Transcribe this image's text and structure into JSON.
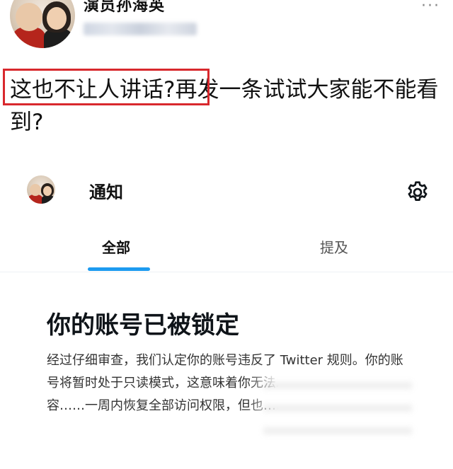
{
  "tweet": {
    "author_name": "演员孙海英",
    "more_label": "···",
    "highlighted_text": "这也不让人讲话?",
    "rest_text": "再发一条试试大家能不能看到?"
  },
  "notifications": {
    "title": "通知",
    "settings_icon": "gear-icon",
    "tabs": [
      {
        "label": "全部",
        "active": true
      },
      {
        "label": "提及",
        "active": false
      }
    ]
  },
  "lock_notice": {
    "heading": "你的账号已被锁定",
    "body": "经过仔细审查，我们认定你的账号违反了 Twitter 规则。你的账号将暂时处于只读模式，这意味着你无法发推、转推或喜欢内容……一周内恢复全部访问权限，但也……间。"
  },
  "colors": {
    "accent": "#1d9bf0",
    "highlight_border": "#d8282d"
  }
}
